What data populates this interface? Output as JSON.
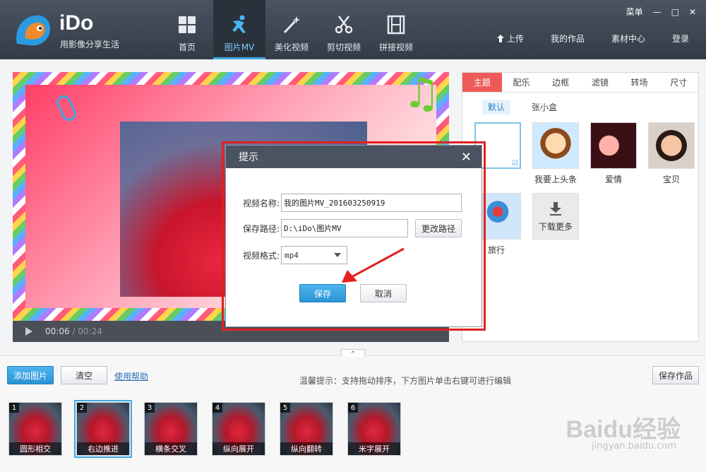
{
  "app": {
    "brand": "iDo",
    "slogan": "用影像分享生活"
  },
  "nav": [
    {
      "label": "首页",
      "icon": "grid-icon",
      "active": false
    },
    {
      "label": "图片MV",
      "icon": "figure-icon",
      "active": true
    },
    {
      "label": "美化视频",
      "icon": "magic-wand-icon",
      "active": false
    },
    {
      "label": "剪切视频",
      "icon": "scissors-icon",
      "active": false
    },
    {
      "label": "拼接视频",
      "icon": "film-icon",
      "active": false
    }
  ],
  "window": {
    "menu_label": "菜单",
    "minimize": "—",
    "maximize": "□",
    "close": "✕"
  },
  "header_links": {
    "upload": "上传",
    "my_works": "我的作品",
    "materials": "素材中心",
    "login": "登录"
  },
  "player": {
    "current_time": "00:06",
    "separator": " / ",
    "total_time": "00:24"
  },
  "panel": {
    "tabs": [
      "主题",
      "配乐",
      "边框",
      "滤镜",
      "转场",
      "尺寸"
    ],
    "active_tab": 0,
    "subtabs": [
      "默认",
      "张小盒"
    ],
    "active_subtab": 0,
    "themes": [
      {
        "label": "",
        "selected": true
      },
      {
        "label": "我要上头条"
      },
      {
        "label": "爱情"
      },
      {
        "label": "宝贝"
      },
      {
        "label": "旅行"
      },
      {
        "label": "下载更多"
      }
    ]
  },
  "dialog": {
    "title": "提示",
    "name_label": "视频名称:",
    "name_value": "我的图片MV_201603250919",
    "path_label": "保存路径:",
    "path_value": "D:\\iDo\\图片MV",
    "change_path": "更改路径",
    "format_label": "视频格式:",
    "format_value": "mp4",
    "save": "保存",
    "cancel": "取消"
  },
  "bottom": {
    "add_image": "添加图片",
    "clear": "清空",
    "help": "使用帮助",
    "tip": "温馨提示：支持拖动排序，下方图片单击右键可进行编辑",
    "save_work": "保存作品"
  },
  "clips": [
    {
      "num": "1",
      "name": "圆形相交"
    },
    {
      "num": "2",
      "name": "右边推进",
      "selected": true
    },
    {
      "num": "3",
      "name": "横条交叉"
    },
    {
      "num": "4",
      "name": "纵向展开"
    },
    {
      "num": "5",
      "name": "纵向翻转"
    },
    {
      "num": "6",
      "name": "米字展开"
    }
  ],
  "watermark": {
    "main": "Baidu经验",
    "sub": "jingyan.baidu.com"
  }
}
